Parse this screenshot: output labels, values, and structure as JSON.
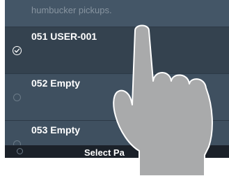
{
  "description": {
    "text": "humbucker pickups."
  },
  "presets": [
    {
      "label": "051 USER-001",
      "selected": true
    },
    {
      "label": "052 Empty",
      "selected": false
    },
    {
      "label": "053 Empty",
      "selected": false
    }
  ],
  "bottom_bar": {
    "label": "Select Pa"
  },
  "gesture": {
    "icon": "tap-hand-icon"
  },
  "colors": {
    "list_bg": "#3f5060",
    "selected_bg": "#34424f",
    "bottom_bar_bg": "#1b2129",
    "hand_fill": "#a9aaab",
    "hand_outline": "#ffffff"
  }
}
